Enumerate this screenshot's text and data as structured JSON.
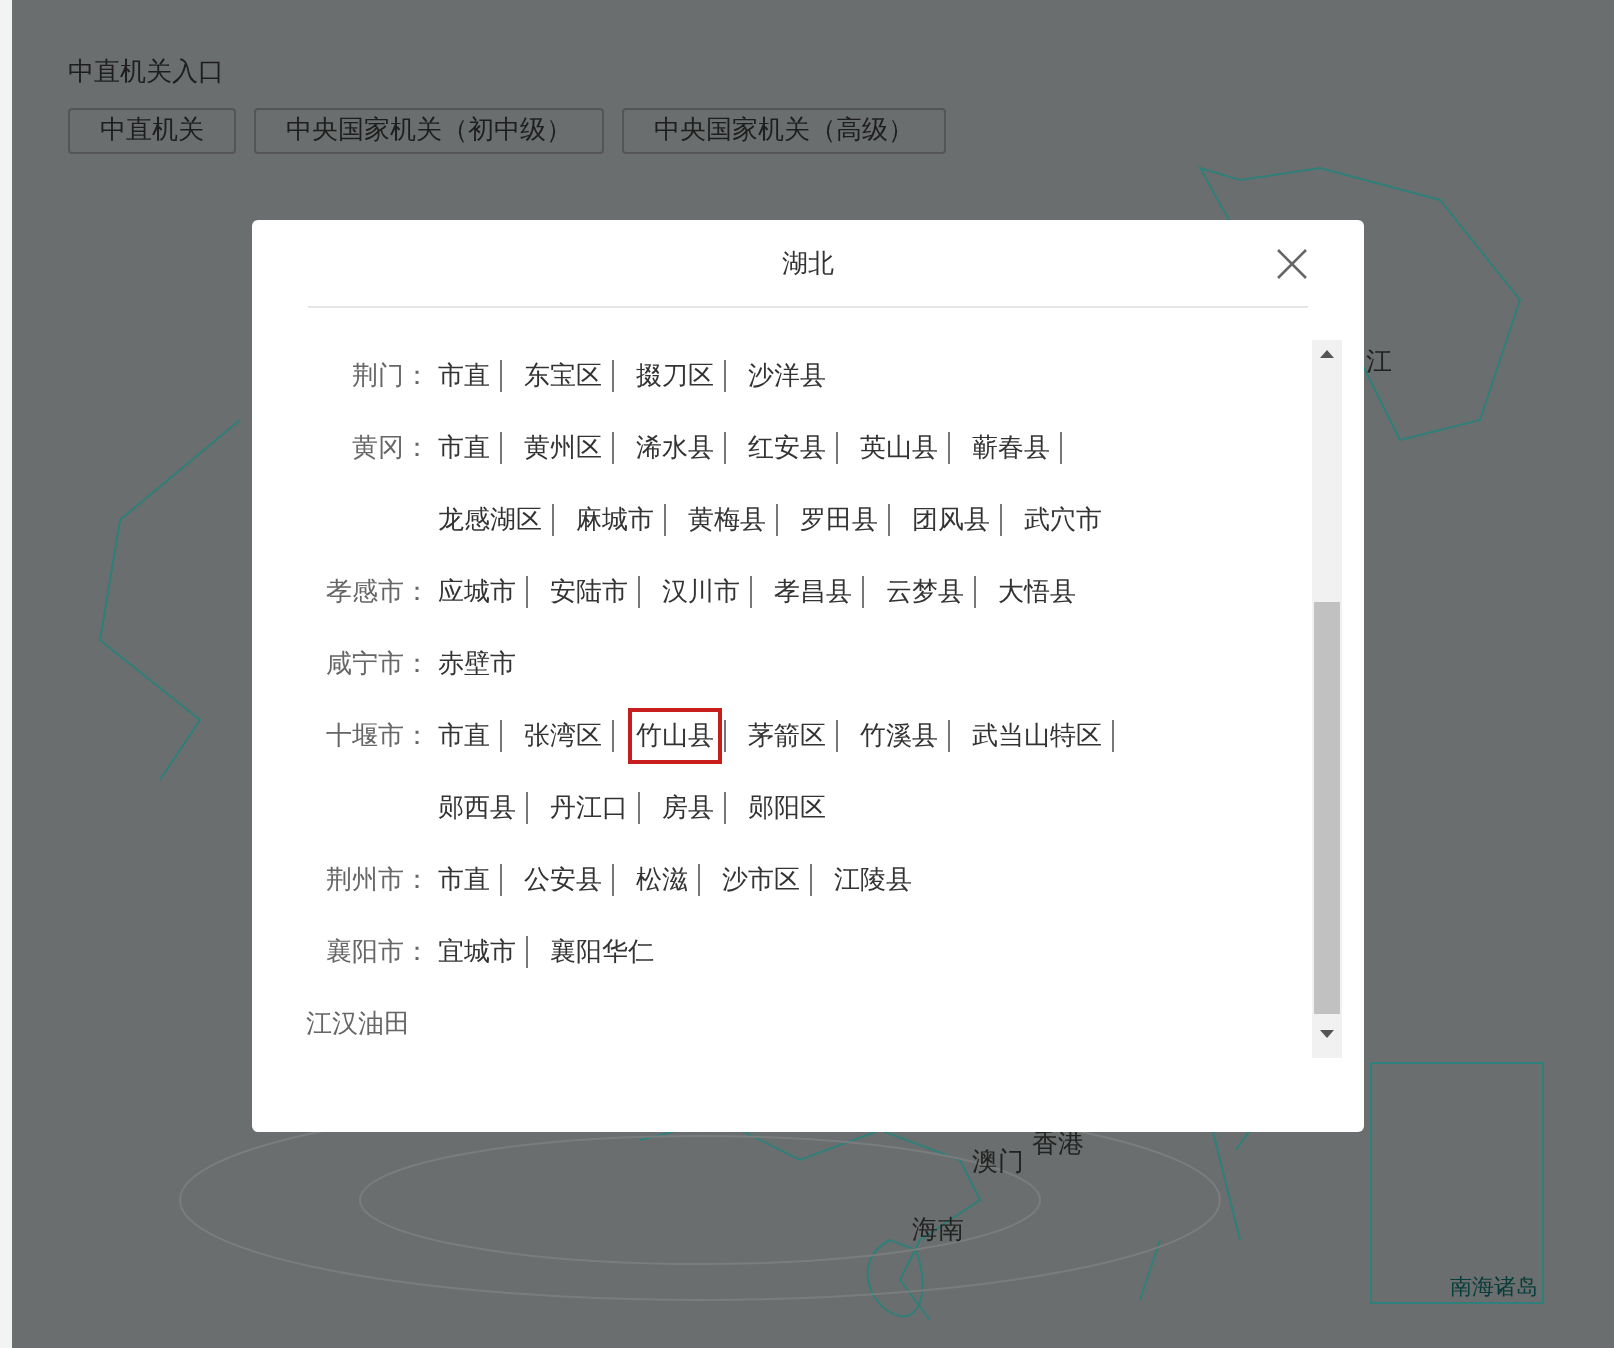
{
  "page": {
    "heading": "中直机关入口",
    "buttons": [
      "中直机关",
      "中央国家机关（初中级）",
      "中央国家机关（高级）"
    ]
  },
  "map": {
    "labels": [
      "江",
      "香港",
      "澳门",
      "海南"
    ],
    "inset_label": "南海诸岛"
  },
  "dialog": {
    "title": "湖北",
    "regions": [
      {
        "name": "荆门：",
        "items": [
          {
            "label": "市直",
            "selected": false
          },
          {
            "label": "东宝区",
            "selected": false
          },
          {
            "label": "掇刀区",
            "selected": false
          },
          {
            "label": "沙洋县",
            "selected": false
          }
        ]
      },
      {
        "name": "黄冈：",
        "items": [
          {
            "label": "市直",
            "selected": false
          },
          {
            "label": "黄州区",
            "selected": false
          },
          {
            "label": "浠水县",
            "selected": false
          },
          {
            "label": "红安县",
            "selected": false
          },
          {
            "label": "英山县",
            "selected": false
          },
          {
            "label": "蕲春县",
            "selected": false
          },
          {
            "label": "龙感湖区",
            "selected": false
          },
          {
            "label": "麻城市",
            "selected": false
          },
          {
            "label": "黄梅县",
            "selected": false
          },
          {
            "label": "罗田县",
            "selected": false
          },
          {
            "label": "团风县",
            "selected": false
          },
          {
            "label": "武穴市",
            "selected": false
          }
        ]
      },
      {
        "name": "孝感市：",
        "items": [
          {
            "label": "应城市",
            "selected": false
          },
          {
            "label": "安陆市",
            "selected": false
          },
          {
            "label": "汉川市",
            "selected": false
          },
          {
            "label": "孝昌县",
            "selected": false
          },
          {
            "label": "云梦县",
            "selected": false
          },
          {
            "label": "大悟县",
            "selected": false
          }
        ]
      },
      {
        "name": "咸宁市：",
        "items": [
          {
            "label": "赤壁市",
            "selected": false
          }
        ]
      },
      {
        "name": "十堰市：",
        "items": [
          {
            "label": "市直",
            "selected": false
          },
          {
            "label": "张湾区",
            "selected": false
          },
          {
            "label": "竹山县",
            "selected": true
          },
          {
            "label": "茅箭区",
            "selected": false
          },
          {
            "label": "竹溪县",
            "selected": false
          },
          {
            "label": "武当山特区",
            "selected": false
          },
          {
            "label": "郧西县",
            "selected": false
          },
          {
            "label": "丹江口",
            "selected": false
          },
          {
            "label": "房县",
            "selected": false
          },
          {
            "label": "郧阳区",
            "selected": false
          }
        ]
      },
      {
        "name": "荆州市：",
        "items": [
          {
            "label": "市直",
            "selected": false
          },
          {
            "label": "公安县",
            "selected": false
          },
          {
            "label": "松滋",
            "selected": false
          },
          {
            "label": "沙市区",
            "selected": false
          },
          {
            "label": "江陵县",
            "selected": false
          }
        ]
      },
      {
        "name": "襄阳市：",
        "items": [
          {
            "label": "宜城市",
            "selected": false
          },
          {
            "label": "襄阳华仁",
            "selected": false
          }
        ]
      },
      {
        "name": "江汉油田"
      }
    ]
  }
}
